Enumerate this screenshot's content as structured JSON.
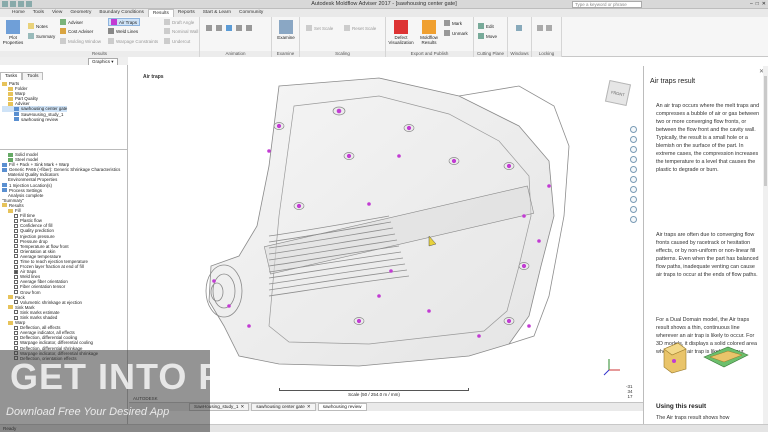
{
  "app_title": "Autodesk Moldflow Adviser 2017",
  "project_title": "[sawhousing center gate]",
  "search_placeholder": "Type a keyword or phrase",
  "ribbon_tabs": [
    "Home",
    "Tools",
    "View",
    "Geometry",
    "Boundary Conditions",
    "Results",
    "Reports",
    "Start & Learn",
    "Community"
  ],
  "ribbon": {
    "print_properties": "Plot Properties",
    "notes": "Notes",
    "summary": "Summary",
    "adviser": "Adviser",
    "cost_adviser": "Cost Adviser",
    "molding_window": "Molding Window",
    "air_traps": "Air Traps",
    "weld_lines": "Weld Lines",
    "warpage_constraints": "Warpage Constraints",
    "draft_angle": "Draft Angle",
    "nominal_wall": "Nominal Wall",
    "undercut": "Undercut",
    "results_group": "Results",
    "animation_group": "Animation",
    "examine": "Examine",
    "examine_group": "Examine",
    "set_scale": "Set Scale",
    "reset_scale": "Reset Scale",
    "scaling_group": "Scaling",
    "defect_visualization": "Defect Visualization",
    "moldflow_results": "Moldflow Results",
    "mark": "Mark",
    "unmark": "Unmark",
    "export_group": "Export and Publish",
    "edit": "Edit",
    "move": "Move",
    "cutting_plane_group": "Cutting Plane",
    "windows_group": "Windows",
    "locking_group": "Locking"
  },
  "graphics_dropdown": "Graphics",
  "left_tabs": [
    "Tasks",
    "Tools"
  ],
  "tree_top": [
    {
      "label": "Parts",
      "icon": "folder",
      "level": 0
    },
    {
      "label": "Folder",
      "icon": "folder",
      "level": 1
    },
    {
      "label": "Warp",
      "icon": "folder",
      "level": 1
    },
    {
      "label": "Part Quality",
      "icon": "folder",
      "level": 1
    },
    {
      "label": "Adviser",
      "icon": "folder",
      "level": 1
    },
    {
      "label": "sawhousing center gate",
      "icon": "study",
      "level": 2,
      "selected": true
    },
    {
      "label": "SawHousing_study_1",
      "icon": "study",
      "level": 2
    },
    {
      "label": "sawhousing review",
      "icon": "study",
      "level": 2
    }
  ],
  "tree_bottom": [
    {
      "label": "Solid model",
      "icon": "green",
      "level": 1
    },
    {
      "label": "Steel model",
      "icon": "green",
      "level": 1
    },
    {
      "label": "Fill + Pack + Sink Mark + Warp",
      "icon": "blue",
      "level": 0
    },
    {
      "label": "Generic PA66 (+fiber): Generic Shrinkage Characteristics",
      "icon": "blue",
      "level": 0
    },
    {
      "label": "Material Quality Indicators",
      "icon": "none",
      "level": 1
    },
    {
      "label": "Environmental Properties",
      "icon": "none",
      "level": 1
    },
    {
      "label": "1 Injection Location(s)",
      "icon": "blue",
      "level": 0
    },
    {
      "label": "Process Settings",
      "icon": "blue",
      "level": 0
    },
    {
      "label": "Analysis complete",
      "icon": "none",
      "level": 1
    },
    {
      "label": "\"Summary\"",
      "icon": "none",
      "level": 0
    },
    {
      "label": "Results",
      "icon": "folder",
      "level": 0
    },
    {
      "label": "Fill",
      "icon": "folder",
      "level": 1
    },
    {
      "label": "Fill time",
      "icon": "cb",
      "level": 2
    },
    {
      "label": "Plastic flow",
      "icon": "cb",
      "level": 2
    },
    {
      "label": "Confidence of fill",
      "icon": "cb",
      "level": 2
    },
    {
      "label": "Quality prediction",
      "icon": "cb",
      "level": 2
    },
    {
      "label": "Injection pressure",
      "icon": "cb",
      "level": 2
    },
    {
      "label": "Pressure drop",
      "icon": "cb",
      "level": 2
    },
    {
      "label": "Temperature at flow front",
      "icon": "cb",
      "level": 2
    },
    {
      "label": "Orientation at skin",
      "icon": "cb",
      "level": 2
    },
    {
      "label": "Average temperature",
      "icon": "cb",
      "level": 2
    },
    {
      "label": "Time to reach ejection temperature",
      "icon": "cb",
      "level": 2
    },
    {
      "label": "Frozen layer fraction at end of fill",
      "icon": "cb",
      "level": 2
    },
    {
      "label": "Air traps",
      "icon": "cbon",
      "level": 2
    },
    {
      "label": "Weld lines",
      "icon": "cb",
      "level": 2
    },
    {
      "label": "Average fiber orientation",
      "icon": "cb",
      "level": 2
    },
    {
      "label": "Fiber orientation tensor",
      "icon": "cb",
      "level": 2
    },
    {
      "label": "Grow from",
      "icon": "cb",
      "level": 2
    },
    {
      "label": "Pack",
      "icon": "folder",
      "level": 1
    },
    {
      "label": "Volumetric shrinkage at ejection",
      "icon": "cb",
      "level": 2
    },
    {
      "label": "Sink Mark",
      "icon": "folder",
      "level": 1
    },
    {
      "label": "Sink marks estimate",
      "icon": "cb",
      "level": 2
    },
    {
      "label": "Sink marks shaded",
      "icon": "cb",
      "level": 2
    },
    {
      "label": "Warp",
      "icon": "folder",
      "level": 1
    },
    {
      "label": "Deflection, all effects",
      "icon": "cb",
      "level": 2
    },
    {
      "label": "Average indicator, all effects",
      "icon": "cb",
      "level": 2
    },
    {
      "label": "Deflection, differential cooling",
      "icon": "cb",
      "level": 2
    },
    {
      "label": "Warpage indicator, differential cooling",
      "icon": "cb",
      "level": 2
    },
    {
      "label": "Deflection, differential shrinkage",
      "icon": "cb",
      "level": 2
    },
    {
      "label": "Warpage indicator, differential shrinkage",
      "icon": "cb",
      "level": 2
    },
    {
      "label": "Deflection, orientation effects",
      "icon": "cb",
      "level": 2
    }
  ],
  "viewport": {
    "title": "Air traps",
    "viewcube_label": "FRONT",
    "scale_text": "Scale (50 / 254.0 m / mm)",
    "ruler": [
      "-31",
      "34",
      "17"
    ],
    "logo_line1": "AUTODESK",
    "logo_line2": "MOLDFLOW ADVISER"
  },
  "doc_tabs": [
    "SawHousing_study_1",
    "sawhousing center gate",
    "sawhousing review"
  ],
  "help": {
    "title": "Air traps result",
    "p1": "An air trap occurs where the melt traps and compresses a bubble of air or gas between two or more converging flow fronts, or between the flow front and the cavity wall. Typically, the result is a small hole or a blemish on the surface of the part. In extreme cases, the compression increases the temperature to a level that causes the plastic to degrade or burn.",
    "p2": "Air traps are often due to converging flow fronts caused by racetrack or hesitation effects, or by non-uniform or non-linear fill patterns. Even when the part has balanced flow paths, inadequate venting can cause air traps to occur at the ends of flow paths.",
    "p3": "For a Dual Domain model, the Air traps result shows a thin, continuous line wherever an air trap is likely to occur. For 3D models, it displays a solid colored area wherever an air trap is likely to occur.",
    "section_title": "Using this result",
    "p4": "The Air traps result shows how"
  },
  "status": "Ready",
  "watermark": {
    "main": "GET INTO PC",
    "sub": "Download Free Your Desired App"
  },
  "colors": {
    "air_trap": "#c23bd3",
    "accent": "#2f6fb5"
  }
}
